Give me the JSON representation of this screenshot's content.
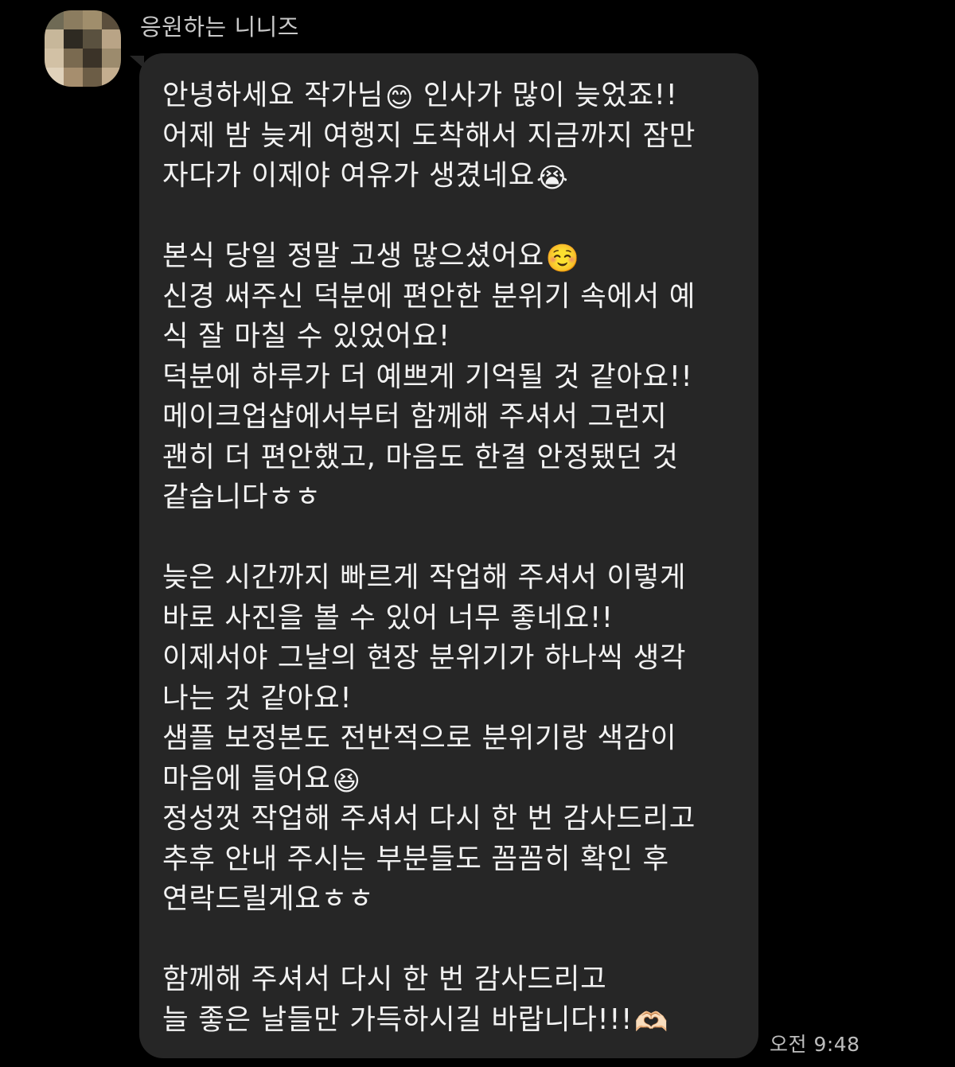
{
  "sender": {
    "name": "응원하는 니니즈",
    "avatar_colors": [
      "#6f6a55",
      "#8b7c5f",
      "#a08e6c",
      "#5b4e3c",
      "#c7b79a",
      "#2e2a22",
      "#5a513f",
      "#b9a486",
      "#d2c1a5",
      "#7a6a50",
      "#3b3328",
      "#9c8b6d",
      "#e0d2bb",
      "#a68e6e",
      "#6c5d46",
      "#c4ae8f"
    ]
  },
  "message": {
    "timestamp": "오전 9:48",
    "bubble_color": "#262626",
    "lines": [
      {
        "text": "안녕하세요 작가님",
        "emoji": "😊",
        "after": " 인사가 많이 늦었죠!!"
      },
      {
        "text": "어제 밤 늦게 여행지 도착해서 지금까지 잠만"
      },
      {
        "text": "자다가 이제야 여유가 생겼네요",
        "emoji": "😭"
      },
      {
        "blank": true
      },
      {
        "text": "본식 당일 정말 고생 많으셨어요",
        "emoji": "☺️"
      },
      {
        "text": "신경 써주신 덕분에 편안한 분위기 속에서 예"
      },
      {
        "text": "식 잘 마칠 수 있었어요!"
      },
      {
        "text": "덕분에 하루가 더 예쁘게 기억될 것 같아요!!"
      },
      {
        "text": "메이크업샵에서부터 함께해 주셔서 그런지"
      },
      {
        "text": "괜히 더 편안했고, 마음도 한결 안정됐던 것"
      },
      {
        "text": "같습니다ㅎㅎ"
      },
      {
        "blank": true
      },
      {
        "text": "늦은 시간까지 빠르게 작업해 주셔서 이렇게"
      },
      {
        "text": "바로 사진을 볼 수 있어 너무 좋네요!!"
      },
      {
        "text": "이제서야 그날의 현장 분위기가 하나씩 생각"
      },
      {
        "text": "나는 것 같아요!"
      },
      {
        "text": "샘플 보정본도 전반적으로 분위기랑 색감이"
      },
      {
        "text": "마음에 들어요",
        "emoji": "😆"
      },
      {
        "text": "정성껏 작업해 주셔서 다시 한 번 감사드리고"
      },
      {
        "text": "추후 안내 주시는 부분들도 꼼꼼히 확인 후"
      },
      {
        "text": "연락드릴게요ㅎㅎ"
      },
      {
        "blank": true
      },
      {
        "text": "함께해 주셔서 다시 한 번 감사드리고"
      },
      {
        "text": "늘 좋은 날들만 가득하시길 바랍니다!!!",
        "emoji": "🫶🏻"
      }
    ]
  }
}
